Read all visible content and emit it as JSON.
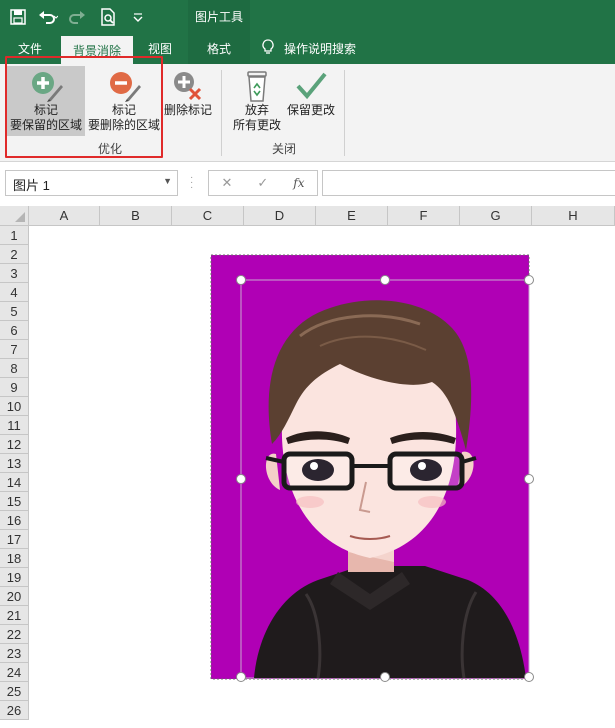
{
  "quick_access": {
    "save_icon": "save-icon",
    "undo_icon": "undo-icon",
    "redo_icon": "redo-icon",
    "print_preview_icon": "print-preview-icon",
    "customize_icon": "customize-qat-icon"
  },
  "context_tool_title": "图片工具",
  "tabs": [
    {
      "label": "文件"
    },
    {
      "label": "背景消除"
    },
    {
      "label": "视图"
    },
    {
      "label": "格式"
    }
  ],
  "tell_me": {
    "icon": "lightbulb-icon",
    "label": "操作说明搜索"
  },
  "ribbon": {
    "group_refine": {
      "label": "优化",
      "mark_keep": {
        "line1": "标记",
        "line2": "要保留的区域"
      },
      "mark_remove": {
        "line1": "标记",
        "line2": "要删除的区域"
      },
      "delete_mark": {
        "label": "删除标记"
      }
    },
    "group_close": {
      "label": "关闭",
      "discard": {
        "line1": "放弃",
        "line2": "所有更改"
      },
      "keep": {
        "label": "保留更改"
      }
    }
  },
  "formula_bar": {
    "name_box": "图片 1",
    "cancel": "✕",
    "enter": "✓",
    "fx": "fx",
    "value": ""
  },
  "columns": [
    "A",
    "B",
    "C",
    "D",
    "E",
    "F",
    "G",
    "H"
  ],
  "rows": [
    "1",
    "2",
    "3",
    "4",
    "5",
    "6",
    "7",
    "8",
    "9",
    "10",
    "11",
    "12",
    "13",
    "14",
    "15",
    "16",
    "17",
    "18",
    "19",
    "20",
    "21",
    "22",
    "23",
    "24",
    "25",
    "26"
  ],
  "colors": {
    "excel_green": "#217346",
    "removal_magenta": "#b000b5",
    "highlight_red": "#e02a2a"
  }
}
